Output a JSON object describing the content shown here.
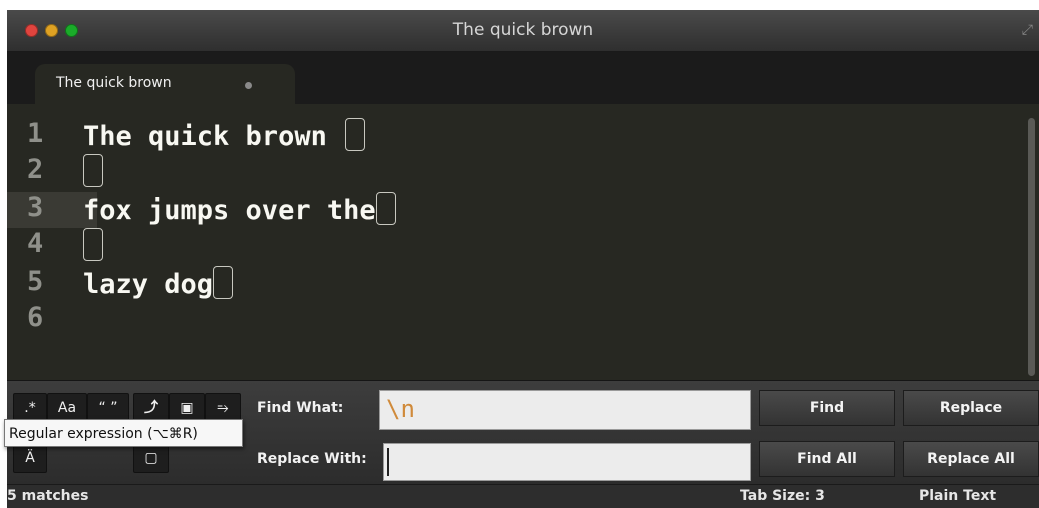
{
  "window": {
    "title": "The quick brown"
  },
  "tab": {
    "label": "The quick brown"
  },
  "editor": {
    "lines": [
      {
        "num": "1",
        "text": "The quick brown "
      },
      {
        "num": "2",
        "text": ""
      },
      {
        "num": "3",
        "text": "fox jumps over the"
      },
      {
        "num": "4",
        "text": ""
      },
      {
        "num": "5",
        "text": "lazy dog"
      },
      {
        "num": "6",
        "text": ""
      }
    ]
  },
  "find_panel": {
    "options": {
      "regex": ".*",
      "case": "Aa",
      "whole_word": "“ ”"
    },
    "find_label": "Find What:",
    "find_value": "\\n",
    "replace_label": "Replace With:",
    "replace_value": "",
    "buttons": {
      "find": "Find",
      "replace": "Replace",
      "find_all": "Find All",
      "replace_all": "Replace All"
    },
    "tooltip": "Regular expression (⌥⌘R)"
  },
  "status_bar": {
    "matches": "5 matches",
    "tab_size": "Tab Size: 3",
    "syntax": "Plain Text"
  },
  "colors": {
    "editor_bg": "#272822",
    "find_text": "#d08a3a",
    "text": "#f8f8f2"
  }
}
